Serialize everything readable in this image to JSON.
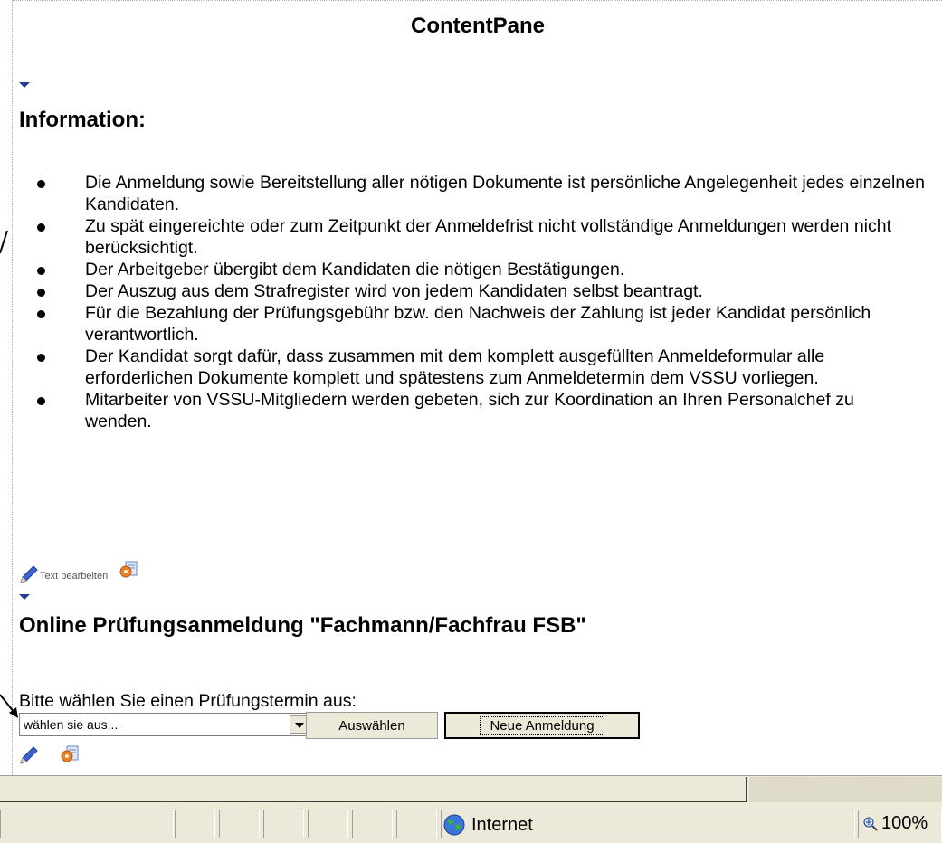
{
  "pane": {
    "title": "ContentPane"
  },
  "info": {
    "heading": "Information:",
    "items": [
      "Die Anmeldung sowie Bereitstellung aller nötigen Dokumente ist persönliche Angelegenheit jedes einzelnen Kandidaten.",
      "Zu spät eingereichte oder zum Zeitpunkt der Anmeldefrist nicht vollständige Anmeldungen werden nicht berücksichtigt.",
      "Der Arbeitgeber übergibt dem Kandidaten die nötigen Bestätigungen.",
      "Der Auszug aus dem Strafregister wird von jedem Kandidaten selbst beantragt.",
      "Für die Bezahlung der Prüfungsgebühr bzw. den Nachweis der Zahlung ist jeder Kandidat persönlich verantwortlich.",
      "Der Kandidat sorgt dafür, dass zusammen mit dem komplett ausgefüllten Anmeldeformular alle erforderlichen Dokumente komplett und spätestens zum Anmeldetermin dem VSSU vorliegen.",
      "Mitarbeiter von VSSU-Mitgliedern werden gebeten, sich zur Koordination an Ihren Personalchef zu wenden."
    ],
    "edit_label": "Text bearbeiten"
  },
  "registration": {
    "heading": "Online Prüfungsanmeldung \"Fachmann/Fachfrau FSB\"",
    "prompt": "Bitte wählen Sie einen Prüfungstermin aus:",
    "select_value": "wählen sie aus...",
    "select_button": "Auswählen",
    "new_button": "Neue Anmeldung"
  },
  "statusbar": {
    "zone": "Internet",
    "zoom": "100%"
  },
  "colors": {
    "arrow": "#1c3f94",
    "chrome": "#ece9d8"
  }
}
